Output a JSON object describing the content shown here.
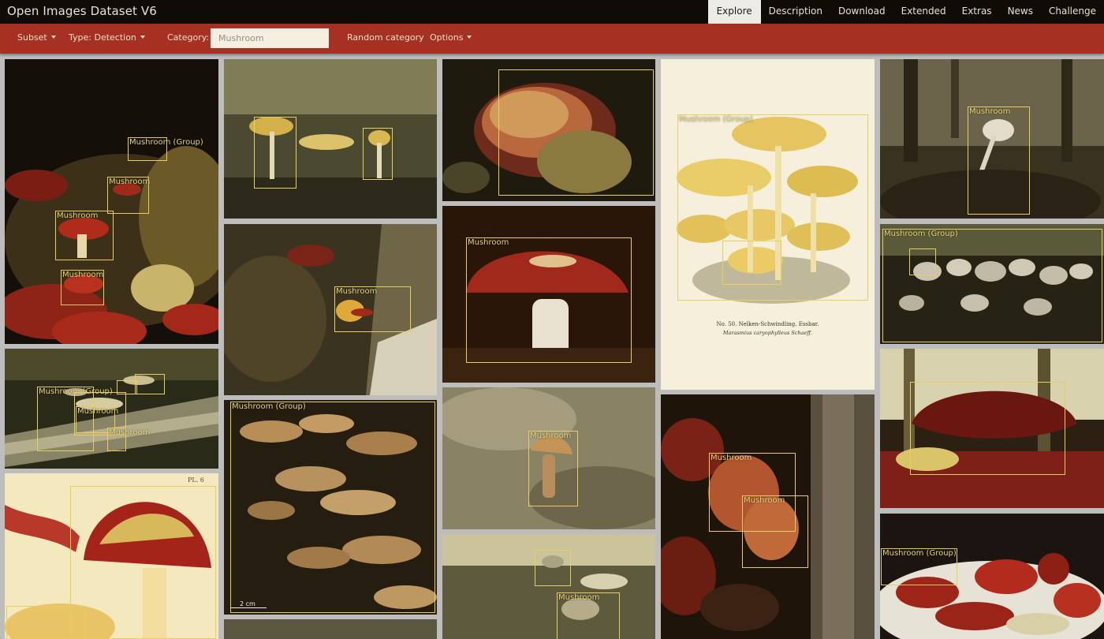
{
  "app": {
    "title": "Open Images Dataset V6"
  },
  "nav": {
    "tabs": [
      "Explore",
      "Description",
      "Download",
      "Extended",
      "Extras",
      "News",
      "Challenge"
    ],
    "active": "Explore"
  },
  "toolbar": {
    "subset_label": "Subset",
    "type_label": "Type: Detection",
    "category_label": "Category:",
    "category_value": "Mushroom",
    "random_label": "Random category",
    "options_label": "Options"
  },
  "labels": {
    "mushroom": "Mushroom",
    "group": "Mushroom (Group)"
  },
  "plate": {
    "caption_line1": "No. 50. Nelken-Schwindling. Essbar.",
    "caption_line2": "Marasmius caryophylleus Schaeff."
  },
  "plate2": {
    "corner": "PL. 6"
  },
  "scale": {
    "label": "2 cm"
  },
  "colors": {
    "navbar": "#0f0b07",
    "toolbar": "#a63122",
    "bbox": "#e8cd60"
  }
}
